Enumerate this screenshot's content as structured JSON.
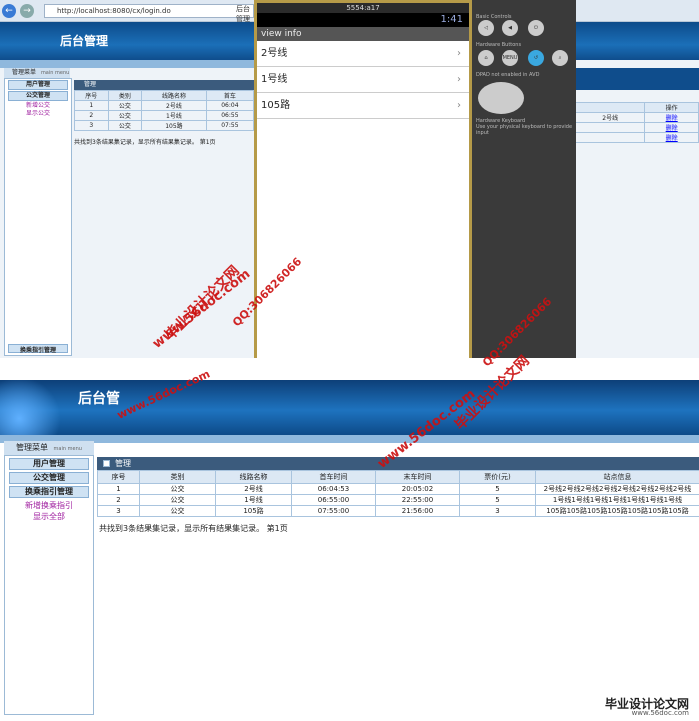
{
  "top": {
    "address": "http://localhost:8080/cx/login.do",
    "tab_label": "后台管理",
    "banner_title": "后台管理",
    "menu_header": "管理菜单",
    "menu_header_en": "main menu",
    "sidebar_items": [
      "用户管理",
      "公交管理"
    ],
    "sidebar_subs": [
      "新增公交",
      "显示公交"
    ],
    "sidebar_bottom": "换乘指引管理",
    "table_title": "管理",
    "headers": [
      "序号",
      "类别",
      "线路名称",
      "首车"
    ],
    "rows": [
      [
        "1",
        "公交",
        "2号线",
        "06:04"
      ],
      [
        "2",
        "公交",
        "1号线",
        "06:55"
      ],
      [
        "3",
        "公交",
        "105路",
        "07:55"
      ]
    ],
    "summary": "共找到3条结果集记录，显示所有结果集记录。 第1页",
    "right_header": "操作",
    "right_rows": [
      "删除",
      "删除",
      "删除"
    ],
    "right_small": "2号线"
  },
  "emulator": {
    "window_title": "5554:a17",
    "time": "1:41",
    "action_title": "view info",
    "items": [
      "2号线",
      "1号线",
      "105路"
    ],
    "labels": {
      "basic": "Basic Controls",
      "hardware": "Hardware Buttons",
      "dpad": "DPAD not enabled in AVD",
      "keyboard": "Hardware Keyboard",
      "keyboard_sub": "Use your physical keyboard to provide input",
      "menu": "MENU"
    }
  },
  "bottom": {
    "banner_title": "后台管",
    "menu_header": "管理菜单",
    "menu_header_en": "main menu",
    "sidebar_items": [
      "用户管理",
      "公交管理",
      "换乘指引管理"
    ],
    "sidebar_subs": [
      "新增换乘指引",
      "显示全部"
    ],
    "table_title": "管理",
    "headers": [
      "序号",
      "类别",
      "线路名称",
      "首车时间",
      "末车时间",
      "票价(元)",
      "站点信息"
    ],
    "rows": [
      [
        "1",
        "公交",
        "2号线",
        "06:04:53",
        "20:05:02",
        "5",
        "2号线2号线2号线2号线2号线2号线2号线2号线"
      ],
      [
        "2",
        "公交",
        "1号线",
        "06:55:00",
        "22:55:00",
        "5",
        "1号线1号线1号线1号线1号线1号线1号线"
      ],
      [
        "3",
        "公交",
        "105路",
        "07:55:00",
        "21:56:00",
        "3",
        "105路105路105路105路105路105路105路"
      ]
    ],
    "summary": "共找到3条结果集记录，显示所有结果集记录。 第1页"
  },
  "watermarks": {
    "site": "www.56doc.com",
    "name": "毕业设计论文网",
    "qq": "QQ:306826066"
  },
  "logo": {
    "main": "毕业设计论文网",
    "sub": "www.56doc.com"
  }
}
